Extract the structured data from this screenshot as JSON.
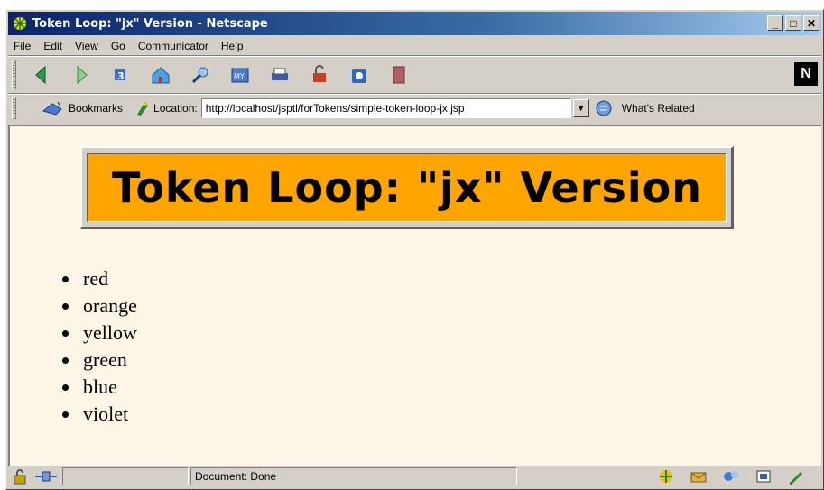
{
  "window": {
    "title": "Token Loop: \"jx\" Version - Netscape",
    "minimize_label": "_",
    "maximize_label": "□",
    "close_label": "✕"
  },
  "menu": [
    "File",
    "Edit",
    "View",
    "Go",
    "Communicator",
    "Help"
  ],
  "toolbar": {
    "icons": [
      "back-icon",
      "forward-icon",
      "reload-icon",
      "home-icon",
      "search-icon",
      "my-netscape-icon",
      "print-icon",
      "security-icon",
      "shop-icon",
      "stop-icon"
    ],
    "logo": "N"
  },
  "location_bar": {
    "bookmarks_label": "Bookmarks",
    "location_label": "Location:",
    "url": "http://localhost/jsptl/forTokens/simple-token-loop-jx.jsp",
    "related_label": "What's Related"
  },
  "page": {
    "heading": "Token Loop: \"jx\" Version",
    "items": [
      "red",
      "orange",
      "yellow",
      "green",
      "blue",
      "violet"
    ],
    "background_color": "#fdf5e6",
    "heading_color": "#ffa500"
  },
  "status": {
    "text": "Document: Done"
  }
}
